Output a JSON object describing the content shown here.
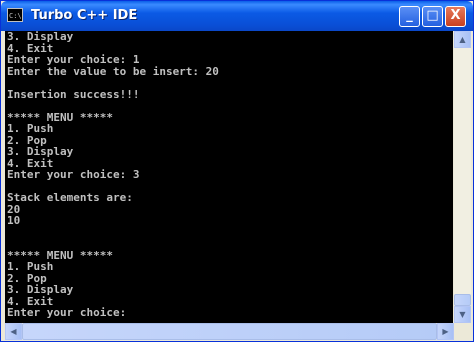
{
  "window": {
    "title": "Turbo C++ IDE",
    "icon": "console-icon",
    "icon_text": "C:\\",
    "controls": {
      "minimize": "_",
      "maximize": "□",
      "close": "X"
    }
  },
  "console": {
    "background": "#000000",
    "text_color": "#c0c0c0",
    "lines": [
      "3. Display",
      "4. Exit",
      "Enter your choice: 1",
      "Enter the value to be insert: 20",
      "",
      "Insertion success!!!",
      "",
      "***** MENU *****",
      "1. Push",
      "2. Pop",
      "3. Display",
      "4. Exit",
      "Enter your choice: 3",
      "",
      "Stack elements are:",
      "20",
      "10",
      "",
      "",
      "***** MENU *****",
      "1. Push",
      "2. Pop",
      "3. Display",
      "4. Exit",
      "Enter your choice:"
    ]
  },
  "scrollbars": {
    "up": "▲",
    "down": "▼",
    "left": "◀",
    "right": "▶",
    "vertical_position": 1.0
  }
}
